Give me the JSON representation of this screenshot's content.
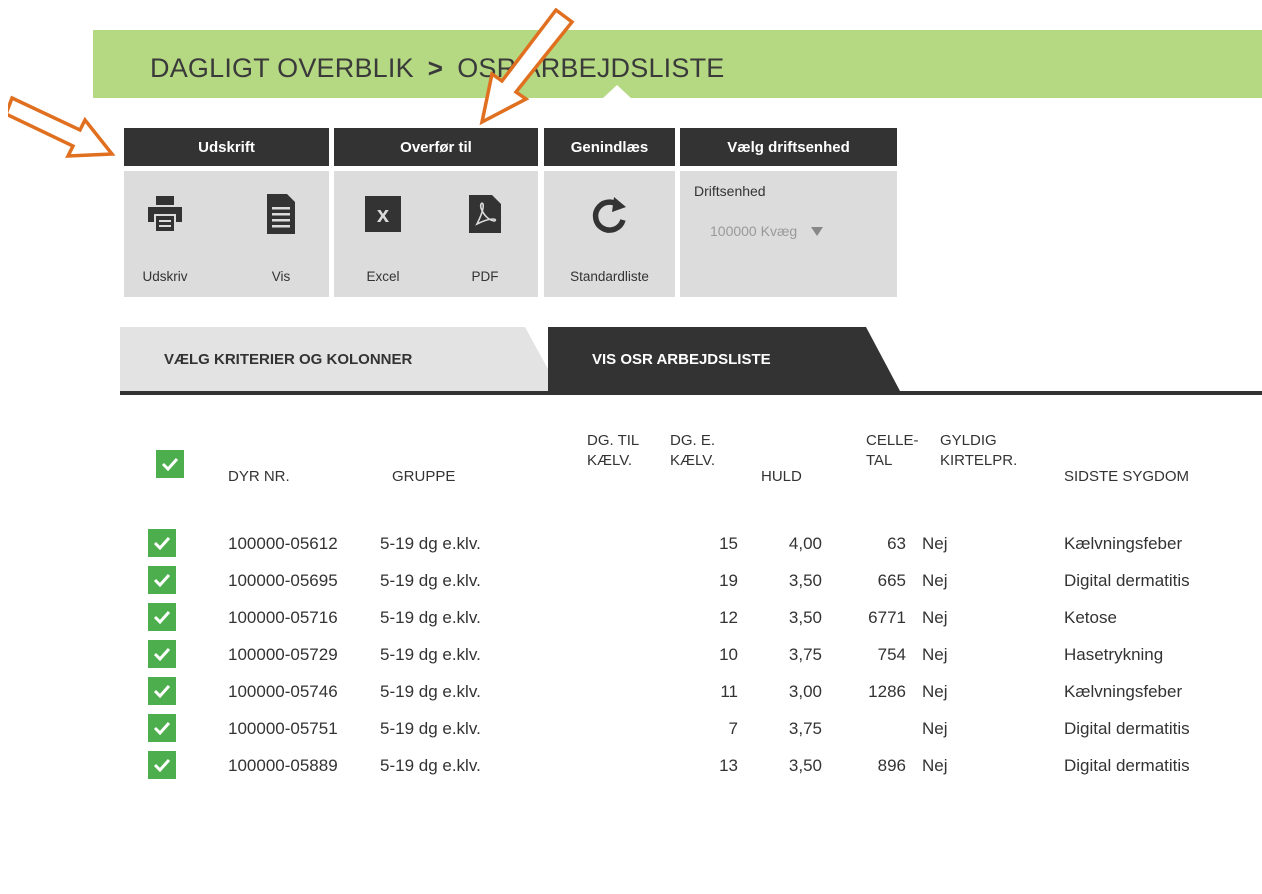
{
  "breadcrumb": {
    "first": "DAGLIGT OVERBLIK",
    "separator": ">",
    "second": "OSR ARBEJDSLISTE"
  },
  "toolbar": {
    "print_group": {
      "title": "Udskrift",
      "print_label": "Udskriv",
      "view_label": "Vis"
    },
    "export_group": {
      "title": "Overfør til",
      "excel_label": "Excel",
      "pdf_label": "PDF"
    },
    "reload_group": {
      "title": "Genindlæs",
      "standard_label": "Standardliste"
    },
    "unit_group": {
      "title": "Vælg driftsenhed",
      "field_label": "Driftsenhed",
      "selected": "100000 Kvæg"
    }
  },
  "tabs": [
    {
      "label": "VÆLG KRITERIER OG KOLONNER",
      "active": false
    },
    {
      "label": "VIS OSR ARBEJDSLISTE",
      "active": true
    }
  ],
  "table": {
    "headers": {
      "dyr_nr": "DYR NR.",
      "gruppe": "GRUPPE",
      "dg_til_kaelv_1": "DG. TIL",
      "dg_til_kaelv_2": "KÆLV.",
      "dg_e_kaelv_1": "DG. E.",
      "dg_e_kaelv_2": "KÆLV.",
      "huld": "HULD",
      "celletal_1": "CELLE-",
      "celletal_2": "TAL",
      "kirtel_1": "GYLDIG",
      "kirtel_2": "KIRTELPR.",
      "sygdom": "SIDSTE SYGDOM"
    },
    "rows": [
      {
        "dyr": "100000-05612",
        "gruppe": "5-19 dg e.klv.",
        "dg_til": "",
        "dg_e": "15",
        "huld": "4,00",
        "celle": "63",
        "kirtel": "Nej",
        "sygdom": "Kælvningsfeber"
      },
      {
        "dyr": "100000-05695",
        "gruppe": "5-19 dg e.klv.",
        "dg_til": "",
        "dg_e": "19",
        "huld": "3,50",
        "celle": "665",
        "kirtel": "Nej",
        "sygdom": "Digital dermatitis"
      },
      {
        "dyr": "100000-05716",
        "gruppe": "5-19 dg e.klv.",
        "dg_til": "",
        "dg_e": "12",
        "huld": "3,50",
        "celle": "6771",
        "kirtel": "Nej",
        "sygdom": "Ketose"
      },
      {
        "dyr": "100000-05729",
        "gruppe": "5-19 dg e.klv.",
        "dg_til": "",
        "dg_e": "10",
        "huld": "3,75",
        "celle": "754",
        "kirtel": "Nej",
        "sygdom": "Hasetrykning"
      },
      {
        "dyr": "100000-05746",
        "gruppe": "5-19 dg e.klv.",
        "dg_til": "",
        "dg_e": "11",
        "huld": "3,00",
        "celle": "1286",
        "kirtel": "Nej",
        "sygdom": "Kælvningsfeber"
      },
      {
        "dyr": "100000-05751",
        "gruppe": "5-19 dg e.klv.",
        "dg_til": "",
        "dg_e": "7",
        "huld": "3,75",
        "celle": "",
        "kirtel": "Nej",
        "sygdom": "Digital dermatitis"
      },
      {
        "dyr": "100000-05889",
        "gruppe": "5-19 dg e.klv.",
        "dg_til": "",
        "dg_e": "13",
        "huld": "3,50",
        "celle": "896",
        "kirtel": "Nej",
        "sygdom": "Digital dermatitis"
      }
    ]
  },
  "colors": {
    "header_green": "#b5d883",
    "dark": "#333333",
    "toolbar_gray": "#dcdcdc",
    "check_green": "#4cae4c",
    "annotation_orange": "#e07020"
  },
  "icons": [
    "printer-icon",
    "document-icon",
    "excel-icon",
    "pdf-icon",
    "refresh-icon",
    "caret-down-icon",
    "checkbox-icon",
    "annotation-arrow-icon"
  ]
}
